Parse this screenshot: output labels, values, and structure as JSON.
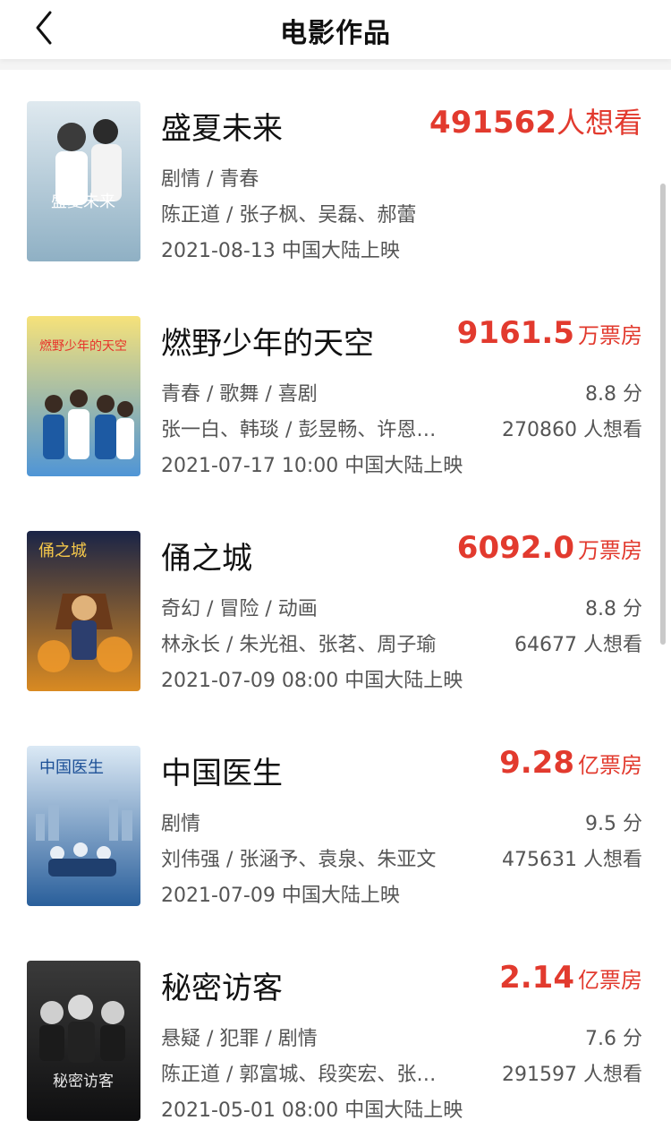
{
  "header": {
    "title": "电影作品"
  },
  "colors": {
    "accent": "#e23a2e",
    "text_primary": "#111111",
    "text_secondary": "#555555"
  },
  "movies": [
    {
      "title": "盛夏未来",
      "metric_num": "491562",
      "metric_unit": "人想看",
      "genres": "剧情 / 青春",
      "people": "陈正道 / 张子枫、吴磊、郝蕾",
      "release": "2021-08-13 中国大陆上映",
      "score": "",
      "wish": ""
    },
    {
      "title": "燃野少年的天空",
      "metric_num": "9161.5",
      "metric_unit": "万票房",
      "genres": "青春 / 歌舞 / 喜剧",
      "people": "张一白、韩琰 / 彭昱畅、许恩…",
      "release": "2021-07-17 10:00 中国大陆上映",
      "score": "8.8 分",
      "wish": "270860 人想看"
    },
    {
      "title": "俑之城",
      "metric_num": "6092.0",
      "metric_unit": "万票房",
      "genres": "奇幻 / 冒险 / 动画",
      "people": "林永长 / 朱光祖、张茗、周子瑜",
      "release": "2021-07-09 08:00 中国大陆上映",
      "score": "8.8 分",
      "wish": "64677 人想看"
    },
    {
      "title": "中国医生",
      "metric_num": "9.28",
      "metric_unit": "亿票房",
      "genres": "剧情",
      "people": "刘伟强 / 张涵予、袁泉、朱亚文",
      "release": "2021-07-09 中国大陆上映",
      "score": "9.5 分",
      "wish": "475631 人想看"
    },
    {
      "title": "秘密访客",
      "metric_num": "2.14",
      "metric_unit": "亿票房",
      "genres": "悬疑 / 犯罪 / 剧情",
      "people": "陈正道 / 郭富城、段奕宏、张…",
      "release": "2021-05-01 08:00 中国大陆上映",
      "score": "7.6 分",
      "wish": "291597 人想看"
    }
  ],
  "posters": [
    {
      "text": "盛夏未来",
      "bg_top": "#dfe9ef",
      "bg_bottom": "#8fb0c4",
      "text_color": "#ffffff"
    },
    {
      "text": "燃野少年的天空",
      "bg_top": "#f6e27a",
      "bg_bottom": "#4f95d6",
      "text_color": "#e7332b"
    },
    {
      "text": "俑之城",
      "bg_top": "#1a2446",
      "bg_bottom": "#d98a22",
      "text_color": "#f5c84a"
    },
    {
      "text": "中国医生",
      "bg_top": "#dbe9f5",
      "bg_bottom": "#2a5f9b",
      "text_color": "#1b4f96"
    },
    {
      "text": "秘密访客",
      "bg_top": "#3a3a3a",
      "bg_bottom": "#0f0f10",
      "text_color": "#e8e8e8"
    }
  ]
}
